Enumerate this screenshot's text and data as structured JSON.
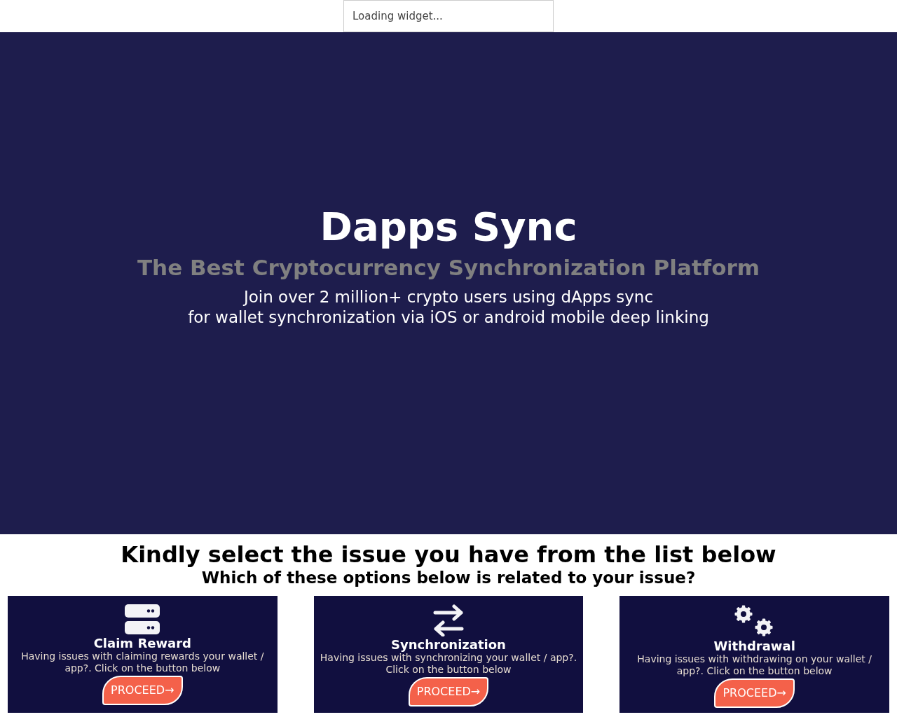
{
  "widget": {
    "text": "Loading widget..."
  },
  "hero": {
    "title": "Dapps Sync",
    "subtitle": "The Best Cryptocurrency Synchronization Platform",
    "lines": [
      "Join over 2 million+ crypto users using dApps sync",
      "for wallet synchronization via iOS or android mobile deep linking"
    ]
  },
  "issues": {
    "heading": "Kindly select the issue you have from the list below",
    "subheading": "Which of these options below is related to your issue?",
    "cards": [
      {
        "kind": "server",
        "title": "Claim Reward",
        "text": "Having issues with claiming rewards your wallet / app?. Click on the button below",
        "button": "PROCEED",
        "arrow": "→"
      },
      {
        "kind": "arrows",
        "title": "Synchronization",
        "text": "Having issues with synchronizing your wallet / app?. Click on the button below",
        "button": "PROCEED",
        "arrow": "→"
      },
      {
        "kind": "gears",
        "title": "Withdrawal",
        "text": "Having issues with withdrawing on your wallet / app?. Click on the button below",
        "button": "PROCEED",
        "arrow": "→"
      }
    ]
  }
}
